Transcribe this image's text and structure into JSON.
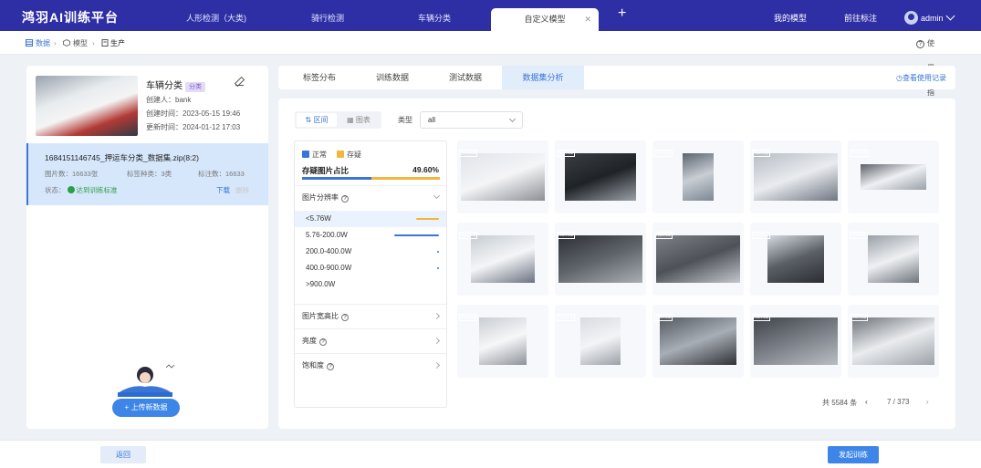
{
  "app_title": "鸿羽AI训练平台",
  "top_tabs": [
    {
      "label": "人形检测（大类)"
    },
    {
      "label": "骑行检测"
    },
    {
      "label": "车辆分类"
    },
    {
      "label": "自定义模型"
    }
  ],
  "top_right": {
    "my_models": "我的模型",
    "go_label": "前往标注",
    "user": "admin"
  },
  "breadcrumb": {
    "data": "数据",
    "model": "模型",
    "prod": "生产"
  },
  "guide": "使用指南",
  "model": {
    "name": "车辆分类",
    "type_tag": "分类",
    "creator": "创建人：bank",
    "created": "创建时间：2023-05-15 19:46",
    "updated": "更新时间：2024-01-12 17:03"
  },
  "dataset": {
    "title": "1684151146745_押运车分类_数据集.zip(8:2)",
    "images": "图片数：16633张",
    "labels": "标签种类：3类",
    "annotations": "标注数：16633",
    "status_label": "状态：",
    "status": "达到训练标准",
    "download": "下载",
    "delete": "删除"
  },
  "upload": "+ 上传新数据",
  "panel_tabs": [
    {
      "label": "标签分布"
    },
    {
      "label": "训练数据"
    },
    {
      "label": "测试数据"
    },
    {
      "label": "数据集分析"
    }
  ],
  "usage": "查看使用记录",
  "view_toggle": {
    "interval": "区间",
    "chart": "图表"
  },
  "type_filter": {
    "label": "类型",
    "value": "all"
  },
  "legend": {
    "normal": "正常",
    "suspect": "存疑"
  },
  "suspect_ratio": {
    "label": "存疑图片占比",
    "value": "49.60%",
    "fraction": 0.496
  },
  "sections": {
    "resolution": "图片分辨率",
    "aspect": "图片宽高比",
    "brightness": "亮度",
    "saturation": "饱和度"
  },
  "resolution_ranges": [
    {
      "label": "<5.76W",
      "share": 0.35,
      "color": "#f3b53d"
    },
    {
      "label": "5.76-200.0W",
      "share": 0.7,
      "color": "#3a75d8"
    },
    {
      "label": "200.0-400.0W",
      "share": 0.02,
      "color": "#3a75d8"
    },
    {
      "label": "400.0-900.0W",
      "share": 0.02,
      "color": "#3a75d8"
    },
    {
      "label": ">900.0W",
      "share": 0,
      "color": "#3a75d8"
    }
  ],
  "images": [
    {
      "label": "Normal"
    },
    {
      "label": "Normal"
    },
    {
      "label": "Normal"
    },
    {
      "label": "Normal"
    },
    {
      "label": "Normal"
    },
    {
      "label": "Normal"
    },
    {
      "label": "Normal"
    },
    {
      "label": "Normal"
    },
    {
      "label": "Normal"
    },
    {
      "label": "Normal"
    },
    {
      "label": "Normal"
    },
    {
      "label": "Normal"
    },
    {
      "label": "Normal"
    },
    {
      "label": "Normal"
    },
    {
      "label": "Normal"
    }
  ],
  "pagination": {
    "total": "共 5584 条",
    "current": "7 / 373"
  },
  "footer": {
    "back": "返回",
    "train": "发起训练"
  }
}
